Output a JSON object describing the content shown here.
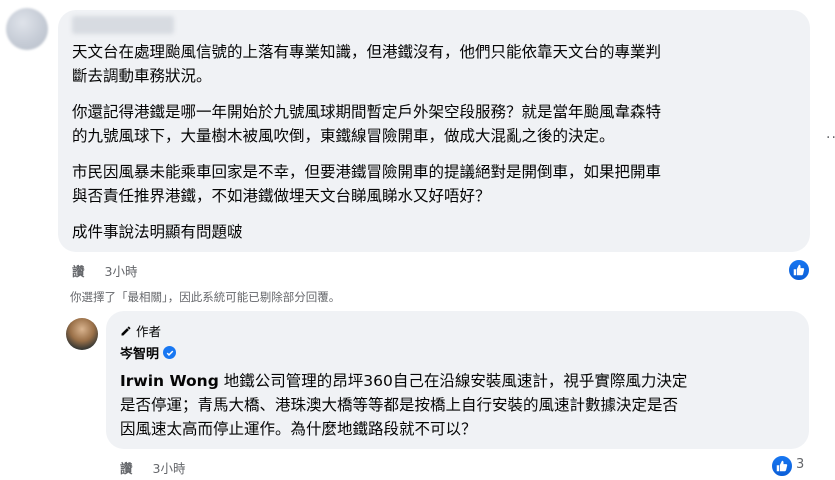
{
  "comment": {
    "author_name_redacted": "",
    "paragraphs": [
      [
        "天文台在處理颱風信號的上落有專業知識，但港鐵沒有，他們只能依靠天文台的專業判",
        "斷去調動車務狀況。"
      ],
      [
        "你還記得港鐵是哪一年開始於九號風球期間暫定戶外架空段服務？就是當年颱風韋森特",
        "的九號風球下，大量樹木被風吹倒，東鐵線冒險開車，做成大混亂之後的決定。"
      ],
      [
        "市民因風暴未能乘車回家是不幸，但要港鐵冒險開車的提議絕對是開倒車，如果把開車",
        "與否責任推界港鐵，不如港鐵做埋天文台睇風睇水又好唔好？"
      ],
      [
        "成件事說法明顯有問題啵"
      ]
    ],
    "like_label": "讚",
    "time": "3小時",
    "reaction_icon": "like-icon"
  },
  "filter_notice": "你選擇了「最相關」，因此系統可能已剔除部分回覆。",
  "reply": {
    "author_badge": "作者",
    "author_name": "岑智明",
    "mention": "Irwin Wong",
    "lines": [
      " 地鐵公司管理的昂坪360自己在沿線安裝風速計，視乎實際風力決定",
      "是否停運；青馬大橋、港珠澳大橋等等都是按橋上自行安裝的風速計數據決定是否",
      "因風速太高而停止運作。為什麼地鐵路段就不可以？"
    ],
    "like_label": "讚",
    "time": "3小時",
    "reaction_count": "3",
    "colors": {
      "accent": "#1877f2",
      "bubble": "#f0f2f5",
      "meta": "#65676b"
    }
  },
  "more_icon": "more-dots-icon"
}
